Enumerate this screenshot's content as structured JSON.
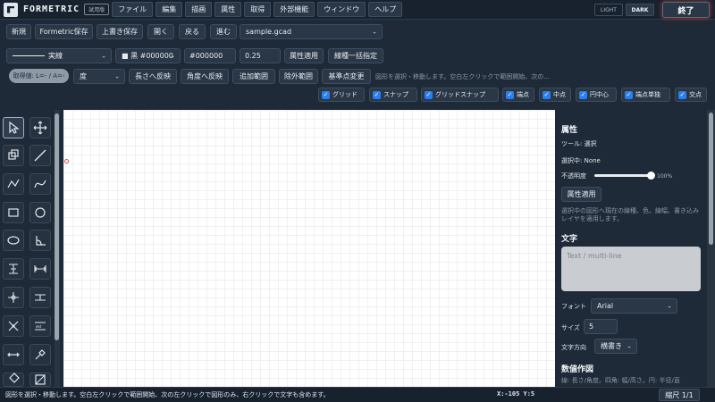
{
  "app": {
    "brand": "FORMETRIC",
    "trial_badge": "試用版"
  },
  "menu": [
    "ファイル",
    "編集",
    "描画",
    "属性",
    "取得",
    "外部機能",
    "ウィンドウ",
    "ヘルプ"
  ],
  "theme": {
    "light": "LIGHT",
    "dark": "DARK",
    "selected": "DARK"
  },
  "exit_label": "終了",
  "file_toolbar": {
    "new": "新規",
    "save_formetric": "Formetric保存",
    "overwrite": "上書き保存",
    "open": "開く",
    "back": "戻る",
    "forward": "進む",
    "file_select": "sample.gcad"
  },
  "attr_toolbar": {
    "line_style": "実線",
    "color_select": "■ 黒 #000000",
    "color_hex": "#000000",
    "line_width": "0.25",
    "apply_attr": "属性適用",
    "batch_line": "線種一括指定"
  },
  "pick_toolbar": {
    "pick_value": "取得値: L=- / A=-",
    "angle_unit": "度",
    "reflect_length": "長さへ反映",
    "reflect_angle": "角度へ反映",
    "add_range": "追加範囲",
    "exclude_range": "除外範囲",
    "change_base": "基準点変更",
    "hint": "図形を選択・移動します。空白左クリックで範囲開始、次の..."
  },
  "snaps": [
    {
      "label": "グリッド",
      "checked": true
    },
    {
      "label": "スナップ",
      "checked": true
    },
    {
      "label": "グリッドスナップ",
      "checked": true
    },
    {
      "label": "端点",
      "checked": true
    },
    {
      "label": "中点",
      "checked": true
    },
    {
      "label": "円中心",
      "checked": true
    },
    {
      "label": "端点単独",
      "checked": true
    },
    {
      "label": "交点",
      "checked": true
    }
  ],
  "properties": {
    "heading": "属性",
    "tool": "ツール: 選択",
    "selecting": "選択中: None",
    "opacity_label": "不透明度",
    "opacity_value": "100%",
    "opacity_fraction": 1.0,
    "apply": "属性適用",
    "note": "選択中の図形へ現在の線種、色、線幅、書き込みレイヤを適用します。"
  },
  "text_section": {
    "heading": "文字",
    "placeholder": "Text / multi-line",
    "font_label": "フォント",
    "font_value": "Arial",
    "size_label": "サイズ",
    "size_value": "5",
    "direction_label": "文字方向",
    "direction_value": "横書き"
  },
  "numeric": {
    "heading": "数値作図",
    "note": "線: 長さ/角度。四角: 幅/高さ。円: 半径/直"
  },
  "status": {
    "message": "図形を選択・移動します。空白左クリックで範囲開始、次の左クリックで図形のみ、右クリックで文字も含めます。",
    "coords": "X:-105 Y:5",
    "scale": "縮尺 1/1"
  }
}
